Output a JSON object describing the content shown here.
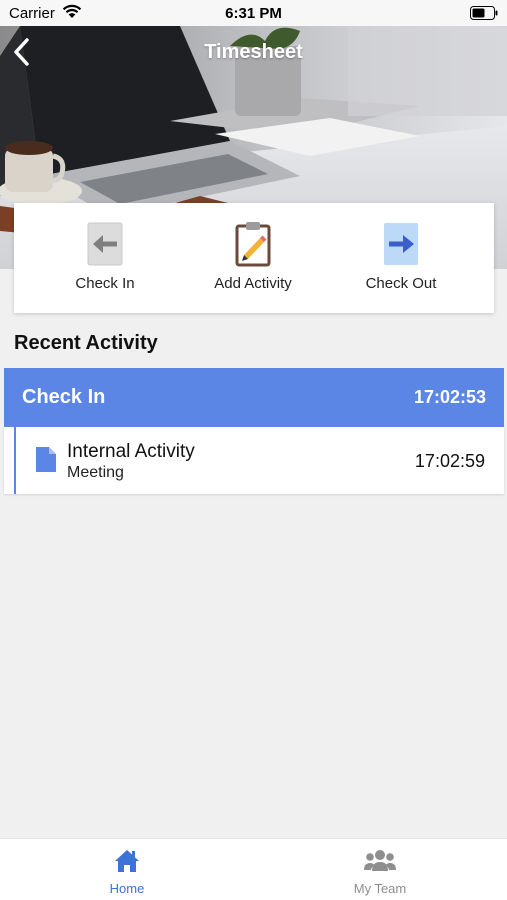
{
  "status_bar": {
    "carrier": "Carrier",
    "time": "6:31 PM"
  },
  "header": {
    "title": "Timesheet"
  },
  "actions": [
    {
      "label": "Check In",
      "icon": "arrow-left-icon"
    },
    {
      "label": "Add Activity",
      "icon": "clipboard-pencil-icon"
    },
    {
      "label": "Check Out",
      "icon": "arrow-right-icon"
    }
  ],
  "recent": {
    "title": "Recent Activity",
    "checkin": {
      "label": "Check In",
      "time": "17:02:53"
    },
    "items": [
      {
        "title": "Internal Activity",
        "subtitle": "Meeting",
        "time": "17:02:59",
        "icon": "document-icon"
      }
    ]
  },
  "tabs": [
    {
      "label": "Home",
      "icon": "home-icon",
      "active": true
    },
    {
      "label": "My Team",
      "icon": "team-icon",
      "active": false
    }
  ],
  "colors": {
    "accent": "#5b86e5",
    "tab_active": "#3d73d6",
    "tab_inactive": "#8e8e8e",
    "checkout_blue": "#3a5fc8"
  }
}
